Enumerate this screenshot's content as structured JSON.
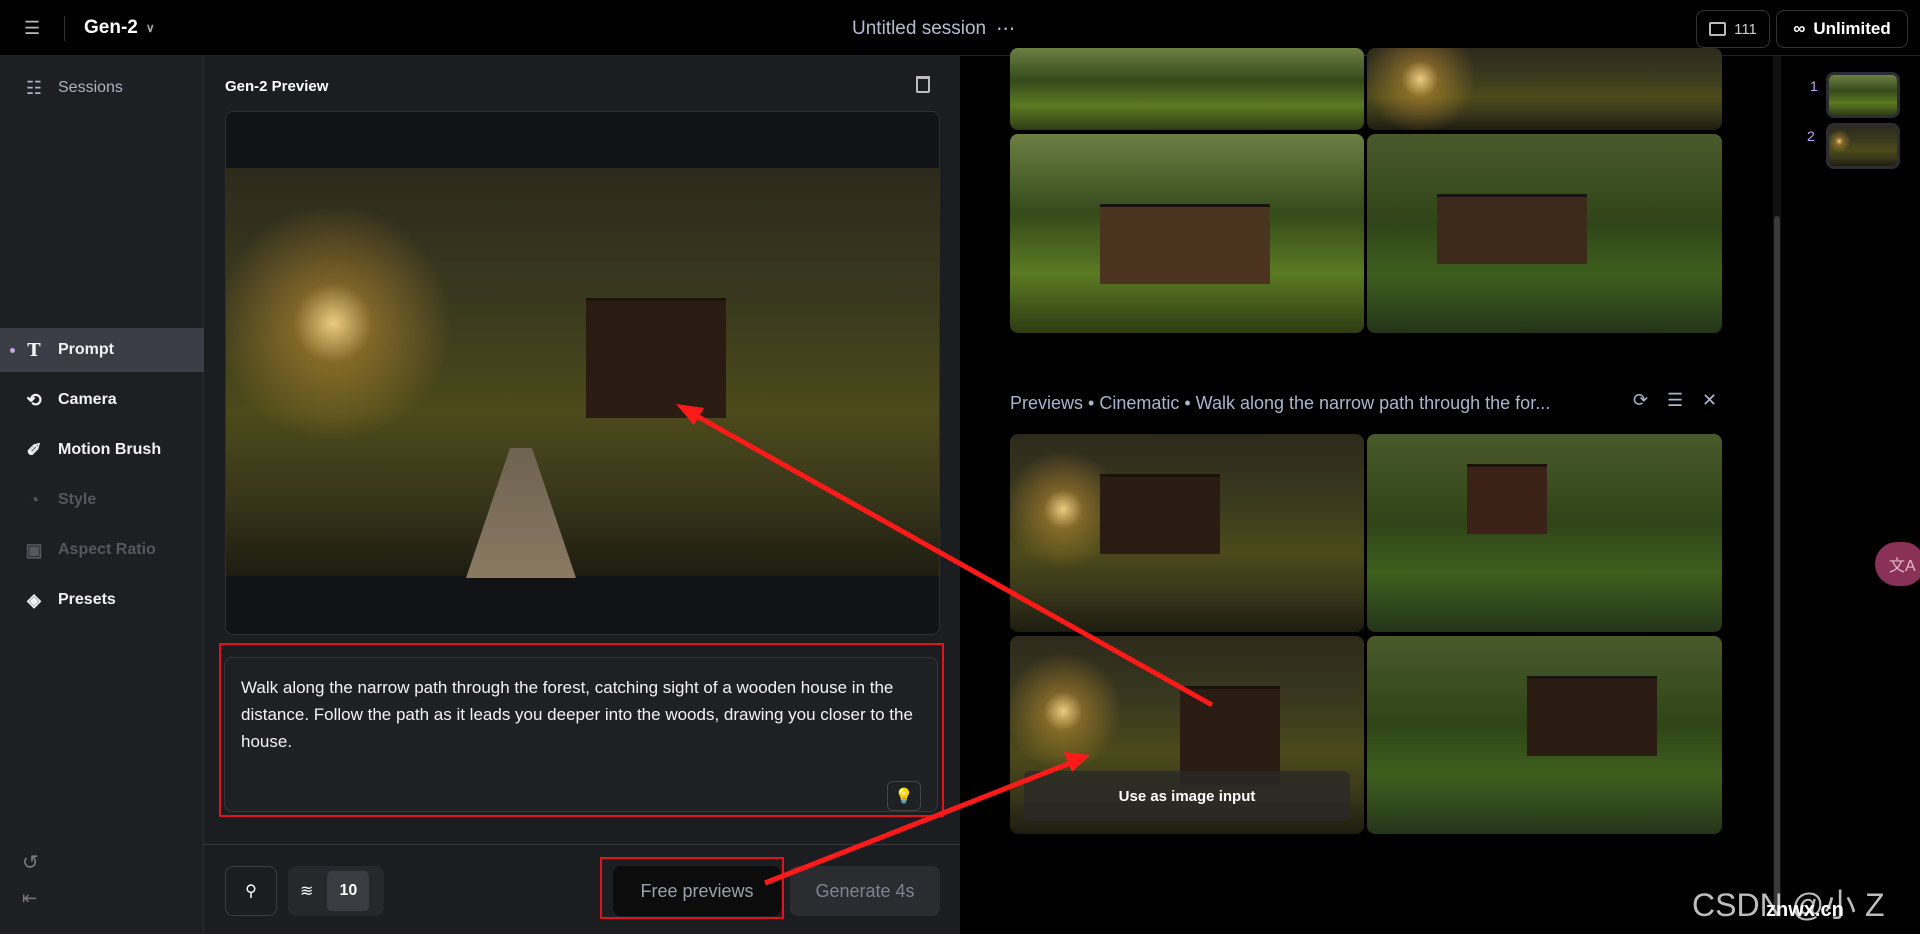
{
  "topbar": {
    "menu_icon": "hamburger-icon",
    "model": "Gen-2",
    "session_title": "Untitled session",
    "assets_count": "111",
    "plan": "Unlimited"
  },
  "sidebar": {
    "items": [
      {
        "label": "Sessions",
        "icon": "sessions-icon",
        "state": "normal"
      },
      {
        "label": "Prompt",
        "icon": "text-icon",
        "state": "active"
      },
      {
        "label": "Camera",
        "icon": "camera-orbit-icon",
        "state": "normal"
      },
      {
        "label": "Motion Brush",
        "icon": "brush-icon",
        "state": "normal"
      },
      {
        "label": "Style",
        "icon": "palette-icon",
        "state": "disabled"
      },
      {
        "label": "Aspect Ratio",
        "icon": "aspect-ratio-icon",
        "state": "disabled"
      },
      {
        "label": "Presets",
        "icon": "layers-icon",
        "state": "normal"
      }
    ]
  },
  "preview": {
    "title": "Gen-2 Preview",
    "prompt": "Walk along the narrow path through the forest, catching sight of a wooden house in the distance. Follow the path as it leads you deeper into the woods, drawing you closer to the house.",
    "motion_value": "10",
    "free_previews": "Free previews",
    "generate": "Generate 4s"
  },
  "results": {
    "group_header": "Previews • Cinematic • Walk along the narrow path through the for...",
    "hover_label": "Use as image input",
    "thumbs": [
      "1",
      "2"
    ]
  },
  "watermark": {
    "text": "CSDN @小 Z",
    "site": "znwx.cn"
  },
  "colors": {
    "annotation": "#ff1a1a",
    "accent_dot": "#c9a3e6",
    "thumb_number": "#c7a8f5"
  }
}
